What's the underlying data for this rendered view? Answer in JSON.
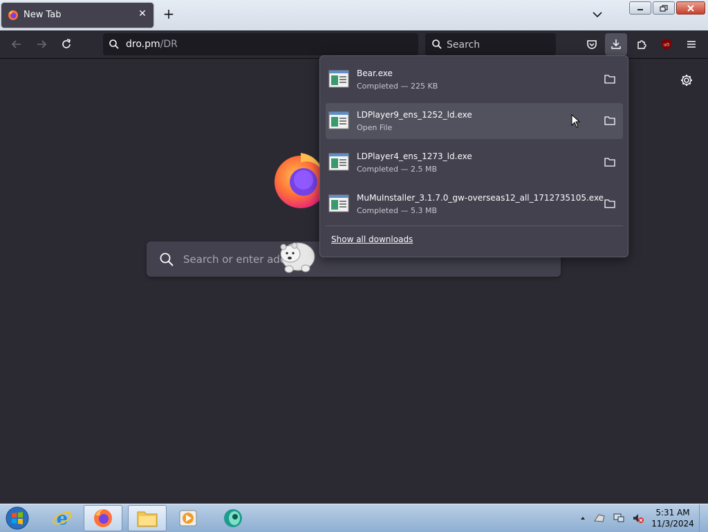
{
  "tab": {
    "title": "New Tab"
  },
  "nav": {
    "url_domain": "dro.pm",
    "url_path": "/DR",
    "search_placeholder": "Search"
  },
  "page": {
    "search_placeholder": "Search or enter addre"
  },
  "downloads": {
    "items": [
      {
        "name": "Bear.exe",
        "status": "Completed — 225 KB"
      },
      {
        "name": "LDPlayer9_ens_1252_ld.exe",
        "status": "Open File"
      },
      {
        "name": "LDPlayer4_ens_1273_ld.exe",
        "status": "Completed — 2.5 MB"
      },
      {
        "name": "MuMuInstaller_3.1.7.0_gw-overseas12_all_1712735105.exe",
        "status": "Completed — 5.3 MB"
      }
    ],
    "show_all": "Show all downloads"
  },
  "taskbar": {
    "time": "5:31 AM",
    "date": "11/3/2024"
  },
  "colors": {
    "page_bg": "#2b2a33",
    "panel_bg": "#42414d",
    "accent": "#0060df"
  }
}
